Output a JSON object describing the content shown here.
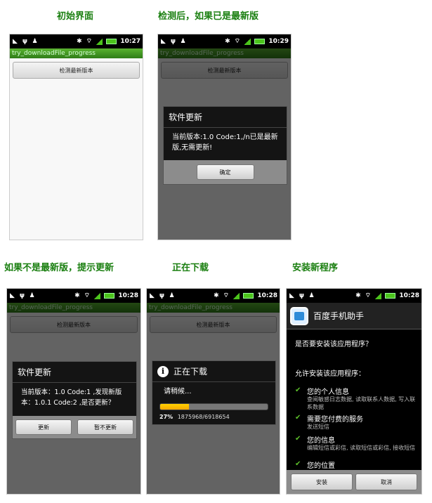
{
  "captions": {
    "initial": "初始界面",
    "latest": "检测后，如果已是最新版",
    "not_latest": "如果不是最新版，提示更新",
    "downloading": "正在下载",
    "install": "安装新程序"
  },
  "app_title": "try_downloadFile_progress",
  "check_button": "检测最新版本",
  "status_times": [
    "10:27",
    "10:29",
    "10:28",
    "10:28",
    "10:28"
  ],
  "dialog_latest": {
    "title": "软件更新",
    "message": "当前版本:1.0 Code:1,/n已是最新版,无需更新!",
    "ok": "确定"
  },
  "dialog_update": {
    "title": "软件更新",
    "message": "当前版本：1.0 Code:1 ,发现新版本：1.0.1 Code:2 ,是否更新？",
    "update": "更新",
    "later": "暂不更新"
  },
  "dialog_download": {
    "title": "正在下载",
    "message": "请稍候...",
    "percent_text": "27%",
    "bytes_text": "1875968/6918654",
    "progress": 0.27
  },
  "installer": {
    "app_name": "百度手机助手",
    "question": "是否要安装该应用程序？",
    "allow": "允许安装该应用程序：",
    "permissions": [
      {
        "name": "您的个人信息",
        "desc": "查阅敏感日志数据, 读取联系人数据, 写入联系数据"
      },
      {
        "name": "需要您付费的服务",
        "desc": "发送短信"
      },
      {
        "name": "您的信息",
        "desc": "编辑短信或彩信, 读取短信或彩信, 接收短信"
      },
      {
        "name": "您的位置",
        "desc": ""
      }
    ],
    "install": "安装",
    "cancel": "取消"
  },
  "colors": {
    "caption": "#1a7f10",
    "titlebar": "#3d8f20",
    "progress": "#f5b400",
    "check": "#5cbf2a"
  }
}
